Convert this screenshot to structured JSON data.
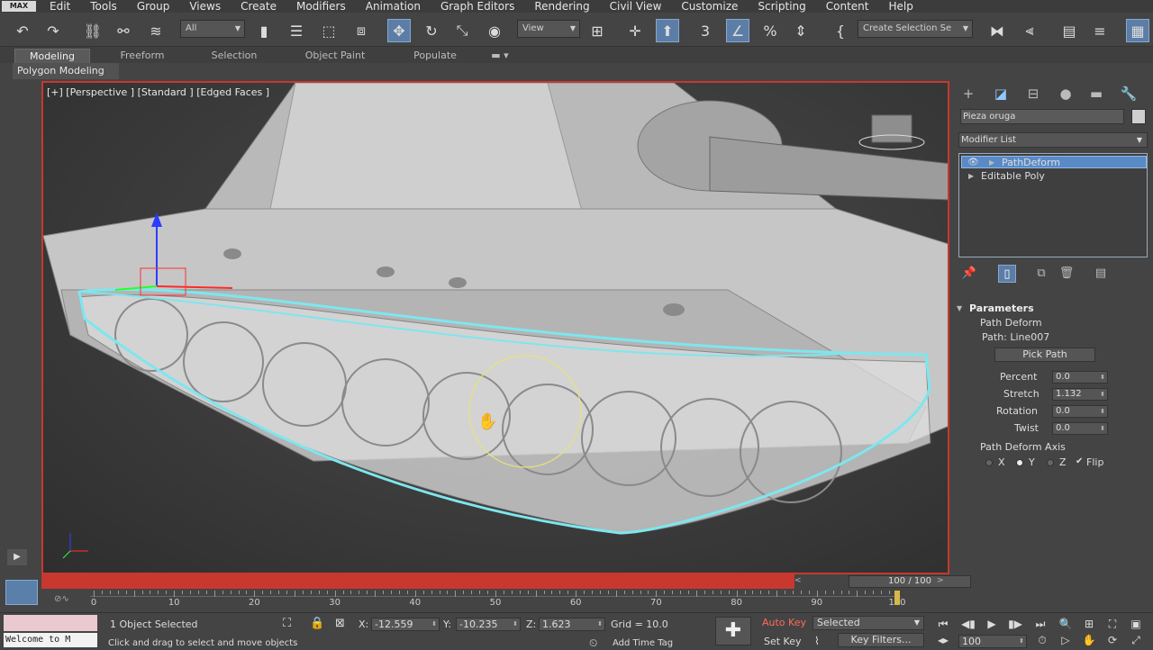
{
  "app": {
    "logo": "MAX"
  },
  "menu": [
    "Edit",
    "Tools",
    "Group",
    "Views",
    "Create",
    "Modifiers",
    "Animation",
    "Graph Editors",
    "Rendering",
    "Civil View",
    "Customize",
    "Scripting",
    "Content",
    "Help"
  ],
  "toolbar": {
    "filter_value": "All",
    "coord_system": "View",
    "selection_set_placeholder": "Create Selection Se"
  },
  "ribbon": {
    "tabs": [
      "Modeling",
      "Freeform",
      "Selection",
      "Object Paint",
      "Populate"
    ],
    "active_tab": "Modeling",
    "sub_label": "Polygon Modeling"
  },
  "viewport": {
    "label": "[+] [Perspective ] [Standard ] [Edged Faces ]"
  },
  "command_panel": {
    "object_name": "Pieza oruga",
    "modifier_list": "Modifier List",
    "stack": [
      {
        "label": "PathDeform",
        "selected": true
      },
      {
        "label": "Editable Poly",
        "selected": false
      }
    ],
    "parameters": {
      "title": "Parameters",
      "group": "Path Deform",
      "path_label": "Path: Line007",
      "pick_path": "Pick Path",
      "percent_label": "Percent",
      "percent_value": "0.0",
      "stretch_label": "Stretch",
      "stretch_value": "1.132",
      "rotation_label": "Rotation",
      "rotation_value": "0.0",
      "twist_label": "Twist",
      "twist_value": "0.0",
      "axis_group": "Path Deform Axis",
      "axis_x": "X",
      "axis_y": "Y",
      "axis_z": "Z",
      "flip": "Flip",
      "selected_axis": "Y",
      "flip_checked": true
    }
  },
  "timeline": {
    "slider": "100 / 100",
    "current_frame": 100,
    "max_frame": 100,
    "ticks": [
      "0",
      "10",
      "20",
      "30",
      "40",
      "50",
      "60",
      "70",
      "80",
      "90",
      "100"
    ]
  },
  "status": {
    "maxscript_text": "Welcome to M",
    "selection": "1 Object Selected",
    "prompt": "Click and drag to select and move objects",
    "x_label": "X:",
    "x_value": "-12.559",
    "y_label": "Y:",
    "y_value": "-10.235",
    "z_label": "Z:",
    "z_value": "1.623",
    "grid": "Grid = 10.0",
    "add_time_tag": "Add Time Tag",
    "auto_key": "Auto Key",
    "set_key": "Set Key",
    "key_mode": "Selected",
    "key_filters": "Key Filters...",
    "frame": "100"
  }
}
